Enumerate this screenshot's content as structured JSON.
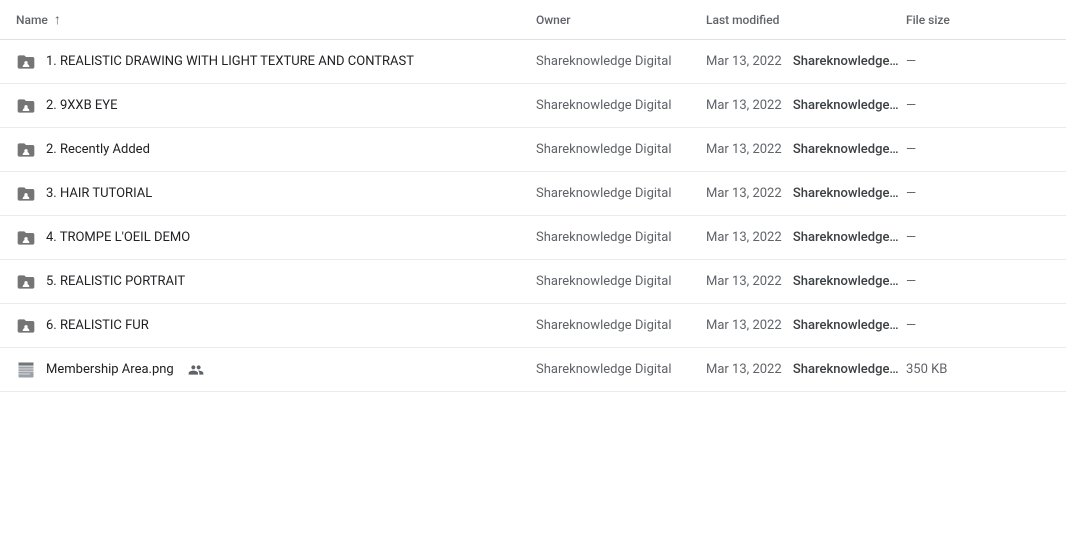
{
  "header": {
    "col_name": "Name",
    "col_owner": "Owner",
    "col_modified": "Last modified",
    "col_size": "File size",
    "sort_arrow": "↑"
  },
  "rows": [
    {
      "id": 1,
      "name": "1. REALISTIC DRAWING WITH LIGHT TEXTURE AND CONTRAST",
      "icon_type": "folder-person",
      "owner": "Shareknowledge Digital",
      "modified_date": "Mar 13, 2022",
      "modified_by": "Shareknowledge…",
      "size": "—",
      "shared": false
    },
    {
      "id": 2,
      "name": "2. 9XXB EYE",
      "icon_type": "folder-person",
      "owner": "Shareknowledge Digital",
      "modified_date": "Mar 13, 2022",
      "modified_by": "Shareknowledge…",
      "size": "—",
      "shared": false
    },
    {
      "id": 3,
      "name": "2. Recently Added",
      "icon_type": "folder-person",
      "owner": "Shareknowledge Digital",
      "modified_date": "Mar 13, 2022",
      "modified_by": "Shareknowledge…",
      "size": "—",
      "shared": false
    },
    {
      "id": 4,
      "name": "3. HAIR TUTORIAL",
      "icon_type": "folder-person",
      "owner": "Shareknowledge Digital",
      "modified_date": "Mar 13, 2022",
      "modified_by": "Shareknowledge…",
      "size": "—",
      "shared": false
    },
    {
      "id": 5,
      "name": "4. TROMPE L'OEIL DEMO",
      "icon_type": "folder-person",
      "owner": "Shareknowledge Digital",
      "modified_date": "Mar 13, 2022",
      "modified_by": "Shareknowledge…",
      "size": "—",
      "shared": false
    },
    {
      "id": 6,
      "name": "5. REALISTIC PORTRAIT",
      "icon_type": "folder-person",
      "owner": "Shareknowledge Digital",
      "modified_date": "Mar 13, 2022",
      "modified_by": "Shareknowledge…",
      "size": "—",
      "shared": false
    },
    {
      "id": 7,
      "name": "6. REALISTIC FUR",
      "icon_type": "folder-person",
      "owner": "Shareknowledge Digital",
      "modified_date": "Mar 13, 2022",
      "modified_by": "Shareknowledge…",
      "size": "—",
      "shared": false
    },
    {
      "id": 8,
      "name": "Membership Area.png",
      "icon_type": "image",
      "owner": "Shareknowledge Digital",
      "modified_date": "Mar 13, 2022",
      "modified_by": "Shareknowledge…",
      "size": "350 KB",
      "shared": true
    }
  ]
}
